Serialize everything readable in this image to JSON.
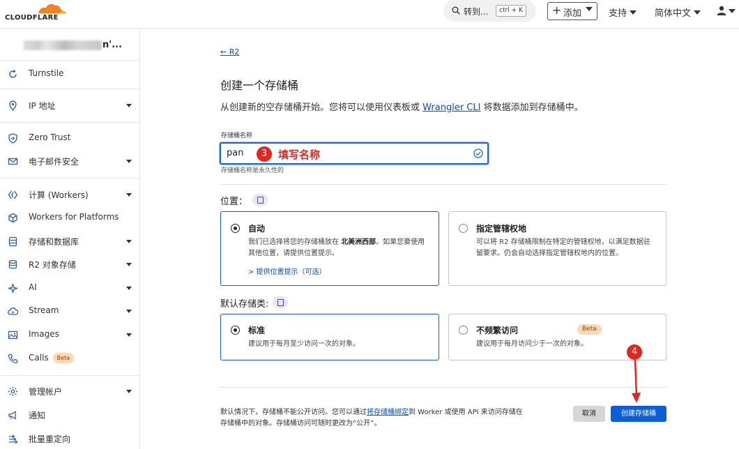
{
  "topbar": {
    "logo_text": "CLOUDFLARE",
    "search_label": "转到...",
    "search_shortcut": "ctrl + K",
    "add_label": "添加",
    "support_label": "支持",
    "language_label": "简体中文"
  },
  "sidebar": {
    "account_suffix": "n'...",
    "items": [
      {
        "label": "Turnstile",
        "icon": "turnstile-icon"
      },
      {
        "label": "IP 地址",
        "icon": "location-pin-icon"
      },
      {
        "label": "Zero Trust",
        "icon": "zero-trust-icon"
      },
      {
        "label": "电子邮件安全",
        "icon": "mail-icon"
      },
      {
        "label": "计算 (Workers)",
        "icon": "workers-icon"
      },
      {
        "label": "Workers for Platforms",
        "icon": "cube-icon"
      },
      {
        "label": "存储和数据库",
        "icon": "storage-icon"
      },
      {
        "label": "R2 对象存储",
        "icon": "database-icon"
      },
      {
        "label": "AI",
        "icon": "ai-sparkle-icon"
      },
      {
        "label": "Stream",
        "icon": "cloud-icon"
      },
      {
        "label": "Images",
        "icon": "image-icon"
      },
      {
        "label": "Calls",
        "icon": "phone-icon",
        "badge": "Beta"
      },
      {
        "label": "管理帐户",
        "icon": "gear-icon"
      },
      {
        "label": "通知",
        "icon": "megaphone-icon"
      },
      {
        "label": "批量重定向",
        "icon": "redirect-icon"
      }
    ]
  },
  "main": {
    "back_link": "R2",
    "title": "创建一个存储桶",
    "desc_before": "从创建新的空存储桶开始。您将可以使用仪表板或 ",
    "desc_link": "Wrangler CLI",
    "desc_after": " 将数据添加到存储桶中。",
    "field_label": "存储桶名称",
    "field_value": "pan",
    "field_help": "存储桶名称是永久性的",
    "annotation3_number": "3",
    "annotation3_text": "填写名称",
    "location_label": "位置：",
    "location_auto_title": "自动",
    "location_auto_desc_before": "我们已选择将您的存储桶放在 ",
    "location_auto_desc_bold": "北美洲西部",
    "location_auto_desc_after": "。如果您要使用其他位置，请提供位置提示。",
    "location_hint_link": "> 提供位置提示（可选）",
    "location_juris_title": "指定管辖权地",
    "location_juris_desc": "可以将 R2 存储桶限制在特定的管辖权地，以满足数据驻留要求。仍会自动选择指定管辖权地内的位置。",
    "storage_label": "默认存储类:",
    "storage_std_title": "标准",
    "storage_std_desc": "建议用于每月至少访问一次的对象。",
    "storage_ia_title": "不频繁访问",
    "storage_ia_badge": "Beta",
    "storage_ia_desc": "建议用于每月访问少于一次的对象。",
    "footer_before": "默认情况下，存储桶不能公开访问。您可以通过",
    "footer_link": "将存储桶绑定",
    "footer_after": "到 Worker 或使用 API 来访问存储在存储桶中的对象。存储桶访问可随时更改为“公开”。",
    "cancel_label": "取消",
    "create_label": "创建存储桶",
    "annotation4_number": "4"
  },
  "colors": {
    "accent": "#0b5ed7",
    "annotation": "#e0261e",
    "brand_orange": "#f6821f"
  }
}
